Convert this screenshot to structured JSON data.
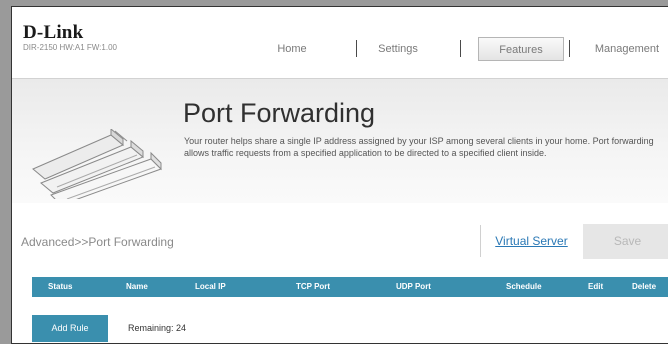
{
  "header": {
    "logo": "D-Link",
    "model": "DIR-2150 HW:A1 FW:1.00"
  },
  "nav": {
    "items": [
      {
        "label": "Home",
        "active": false
      },
      {
        "label": "Settings",
        "active": false
      },
      {
        "label": "Features",
        "active": true
      },
      {
        "label": "Management",
        "active": false
      }
    ]
  },
  "banner": {
    "title": "Port Forwarding",
    "description": "Your router helps share a single IP address assigned by your ISP among several clients in your home. Port forwarding allows traffic requests from a specified application to be directed to a specified client inside."
  },
  "breadcrumb": "Advanced>>Port Forwarding",
  "virtual_server_link": "Virtual Server",
  "save_label": "Save",
  "table": {
    "headers": [
      "Status",
      "Name",
      "Local IP",
      "TCP Port",
      "UDP Port",
      "Schedule",
      "Edit",
      "Delete"
    ]
  },
  "add_rule_label": "Add Rule",
  "remaining": "Remaining: 24",
  "colors": {
    "accent": "#3a8fae",
    "link": "#2a78b5"
  }
}
